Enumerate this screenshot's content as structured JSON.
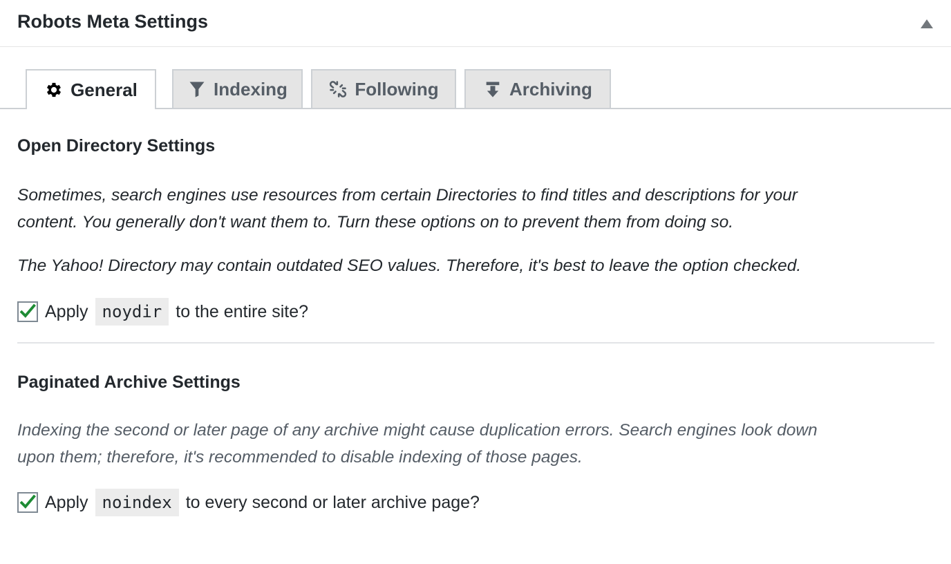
{
  "header": {
    "title": "Robots Meta Settings",
    "toggle_icon": "triangle-up-icon"
  },
  "tabs": [
    {
      "label": "General",
      "icon": "gear-icon",
      "active": true
    },
    {
      "label": "Indexing",
      "icon": "funnel-icon",
      "active": false
    },
    {
      "label": "Following",
      "icon": "broken-link-icon",
      "active": false
    },
    {
      "label": "Archiving",
      "icon": "download-icon",
      "active": false
    }
  ],
  "open_directory": {
    "title": "Open Directory Settings",
    "desc1_line1": "Sometimes, search engines use resources from certain Directories to find titles and descriptions for your",
    "desc1_line2": "content. You generally don't want them to. Turn these options on to prevent them from doing so.",
    "desc2": "The Yahoo! Directory may contain outdated SEO values. Therefore, it's best to leave the option checked.",
    "option": {
      "checked": true,
      "before": "Apply",
      "code": "noydir",
      "after": "to the entire site?"
    }
  },
  "paginated_archive": {
    "title": "Paginated Archive Settings",
    "desc_line1": "Indexing the second or later page of any archive might cause duplication errors. Search engines look down",
    "desc_line2": "upon them; therefore, it's recommended to disable indexing of those pages.",
    "option": {
      "checked": true,
      "before": "Apply",
      "code": "noindex",
      "after": "to every second or later archive page?"
    }
  },
  "colors": {
    "check_mark": "#1e8c35",
    "active_tab_bg": "#ffffff",
    "inactive_tab_bg": "#e5e5e5",
    "text": "#23282d",
    "muted_text": "#555d66"
  }
}
